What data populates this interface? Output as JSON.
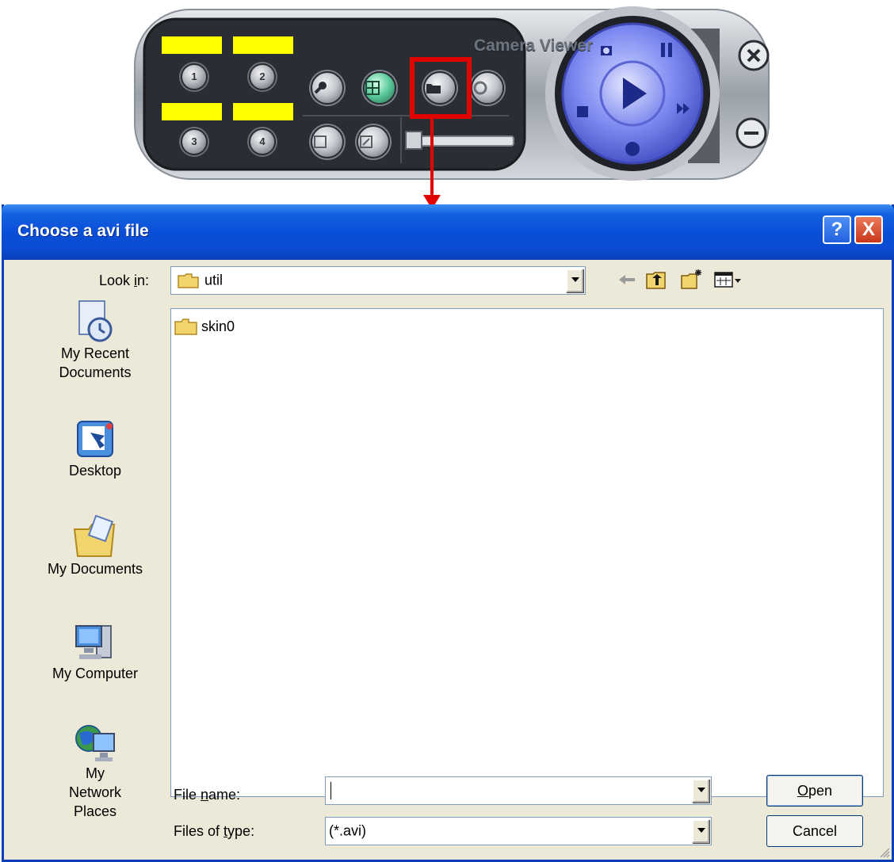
{
  "camera_viewer": {
    "title": "Camera Viewer",
    "channels": [
      "1",
      "2",
      "3",
      "4"
    ]
  },
  "dialog": {
    "title": "Choose a avi file",
    "help_button": "?",
    "close_button": "X",
    "look_in": {
      "label_pre": "Look ",
      "label_accel": "i",
      "label_post": "n:",
      "value": "util"
    },
    "places": [
      {
        "label": "My Recent Documents",
        "icon": "recent-documents-icon"
      },
      {
        "label": "Desktop",
        "icon": "desktop-icon"
      },
      {
        "label": "My Documents",
        "icon": "my-documents-icon"
      },
      {
        "label": "My Computer",
        "icon": "my-computer-icon"
      },
      {
        "label": "My Network Places",
        "icon": "network-places-icon"
      }
    ],
    "files": [
      {
        "name": "skin0",
        "type": "folder"
      }
    ],
    "file_name": {
      "label_pre": "File ",
      "label_accel": "n",
      "label_post": "ame:",
      "value": ""
    },
    "file_type": {
      "label_pre": "Files of ",
      "label_accel": "t",
      "label_post": "ype:",
      "value": "(*.avi)"
    },
    "open_button": {
      "accel": "O",
      "rest": "pen"
    },
    "cancel_button": "Cancel"
  },
  "colors": {
    "highlight": "#e00000",
    "slot": "#ffff00",
    "titlebar": "#0a4fd8"
  }
}
